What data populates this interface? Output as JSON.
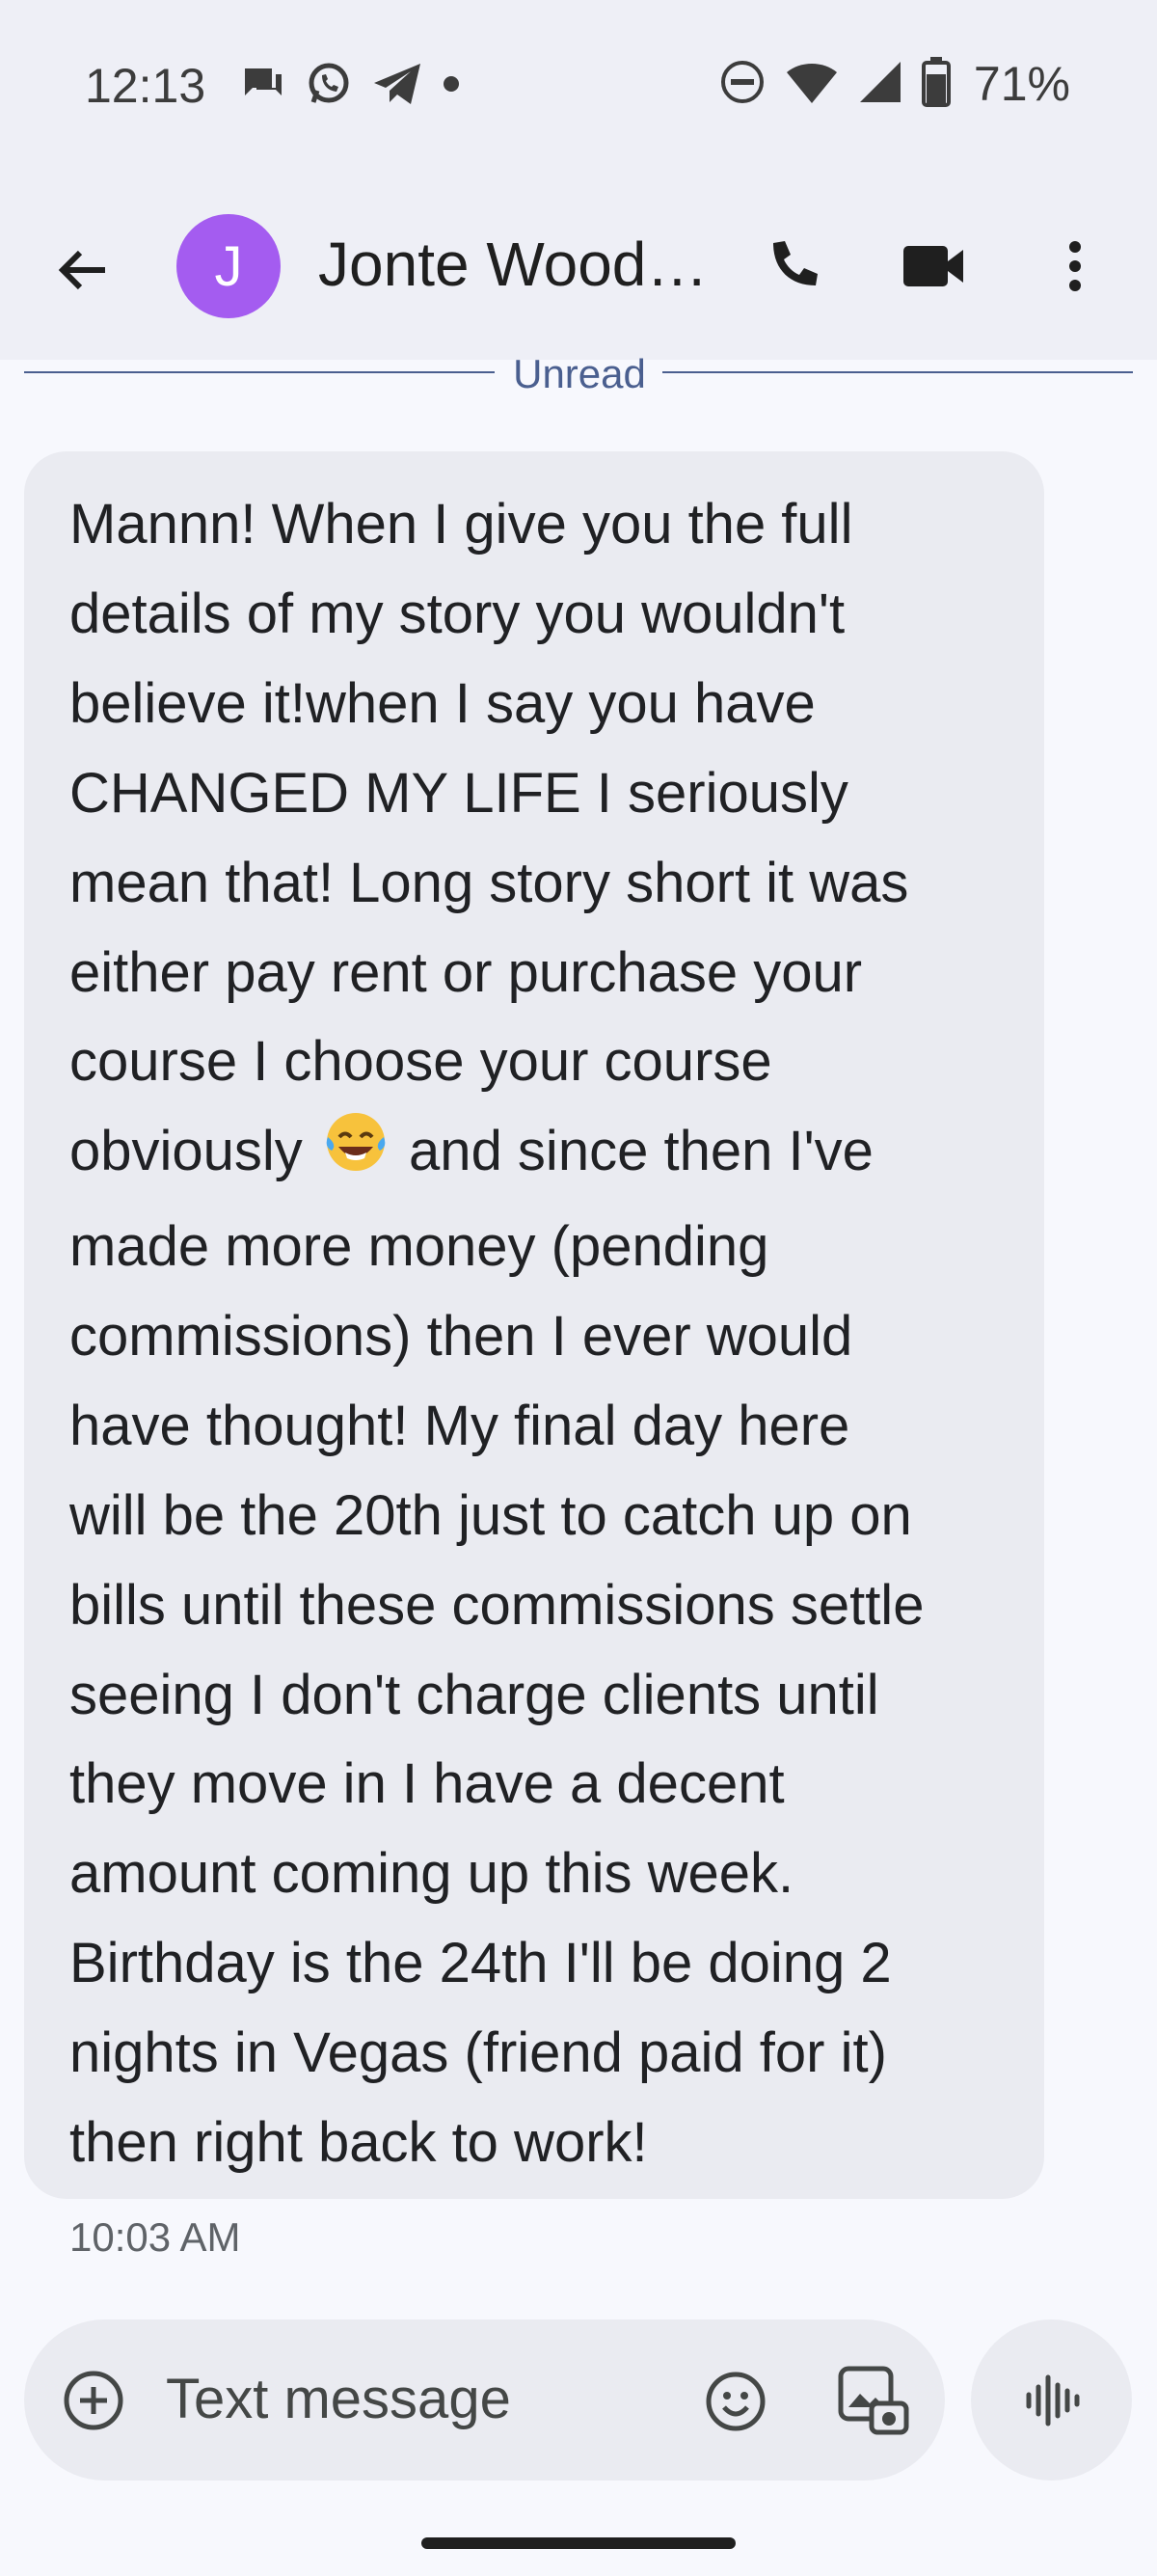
{
  "status_bar": {
    "time": "12:13",
    "battery_percent": "71%",
    "notification_icons": [
      "chat-bubble-icon",
      "whatsapp-icon",
      "telegram-icon",
      "dot-icon"
    ],
    "system_icons": [
      "do-not-disturb-icon",
      "wifi-icon",
      "cellular-signal-icon",
      "battery-icon"
    ]
  },
  "header": {
    "avatar_initial": "J",
    "avatar_color": "#a45cf0",
    "contact_name": "Jonte Wood…",
    "icons": [
      "back-arrow-icon",
      "phone-icon",
      "video-camera-icon",
      "more-vert-icon"
    ]
  },
  "divider": {
    "label": "Unread"
  },
  "message": {
    "lines": [
      "Mannn! When I give you the full",
      "details of my story you wouldn't",
      "believe it!when I say you have",
      "CHANGED MY LIFE I seriously",
      "mean that! Long story short it was",
      "either pay rent or purchase your",
      "course I choose your course",
      "obviously",
      "made more money (pending",
      "commissions) then I ever would",
      "have thought! My final day here",
      "will be the 20th just to catch up on",
      "bills until these commissions settle",
      "seeing I don't charge clients until",
      "they move in I have a decent",
      "amount coming up this week.",
      "Birthday is the 24th I'll be doing 2",
      "nights in Vegas (friend paid for it)",
      "then right back to work!"
    ],
    "line8_after_emoji": " and since then I've",
    "emoji": "face-with-tears-of-joy-icon",
    "timestamp": "10:03 AM"
  },
  "composer": {
    "placeholder": "Text message",
    "value": "",
    "icons": [
      "add-circle-icon",
      "emoji-icon",
      "gallery-icon",
      "voice-wave-icon"
    ]
  },
  "colors": {
    "background": "#f7f8fd",
    "bubble": "#eaebf1",
    "accent": "#4a5f8f"
  }
}
